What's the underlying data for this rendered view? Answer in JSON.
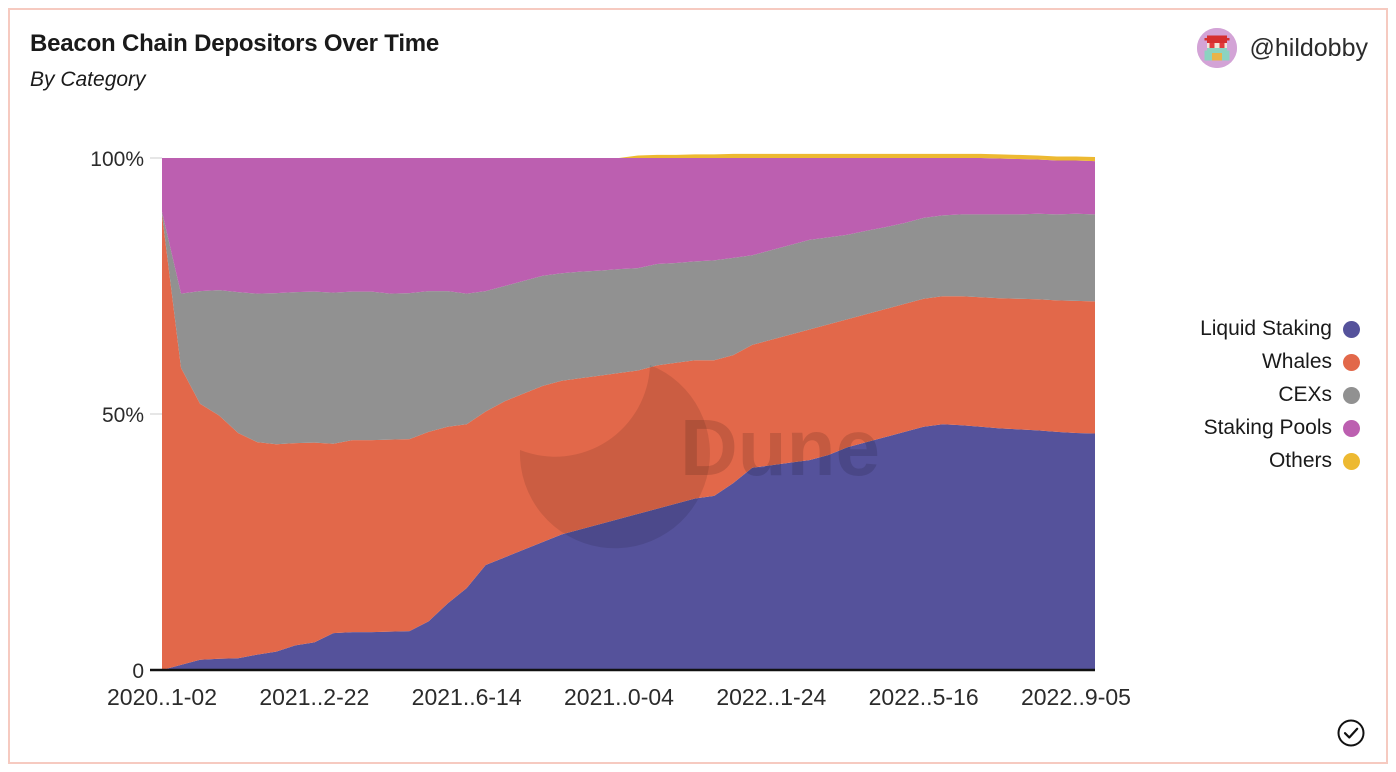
{
  "card": {
    "border_color": "#f6cac0",
    "background": "#ffffff"
  },
  "header": {
    "title": "Beacon Chain Depositors Over Time",
    "subtitle": "By Category",
    "author_handle": "@hildobby",
    "avatar_icon": "pixel-avatar-icon"
  },
  "watermark": {
    "text": "Dune",
    "logo_icon": "dune-crescent-icon"
  },
  "verified_badge": {
    "icon": "check-circle-icon"
  },
  "legend": {
    "position": "right",
    "items": [
      {
        "label": "Liquid Staking",
        "color": "#55529b"
      },
      {
        "label": "Whales",
        "color": "#e2684a"
      },
      {
        "label": "CEXs",
        "color": "#919191"
      },
      {
        "label": "Staking Pools",
        "color": "#bc5fb0"
      },
      {
        "label": "Others",
        "color": "#edb931"
      }
    ]
  },
  "chart_data": {
    "type": "area",
    "stacked": true,
    "normalized": true,
    "title": "Beacon Chain Depositors Over Time",
    "subtitle": "By Category",
    "xlabel": "",
    "ylabel": "",
    "grid": false,
    "ylim": [
      0,
      100
    ],
    "ytick_labels": [
      "0",
      "50%",
      "100%"
    ],
    "ytick_values": [
      0,
      50,
      100
    ],
    "xtick_labels": [
      "2020..1-02",
      "2021..2-22",
      "2021..6-14",
      "2021..0-04",
      "2022..1-24",
      "2022..5-16",
      "2022..9-05"
    ],
    "xtick_indices": [
      0,
      8,
      16,
      24,
      32,
      40,
      48
    ],
    "x": [
      0,
      1,
      2,
      3,
      4,
      5,
      6,
      7,
      8,
      9,
      10,
      11,
      12,
      13,
      14,
      15,
      16,
      17,
      18,
      19,
      20,
      21,
      22,
      23,
      24,
      25,
      26,
      27,
      28,
      29,
      30,
      31,
      32,
      33,
      34,
      35,
      36,
      37,
      38,
      39,
      40,
      41,
      42,
      43,
      44,
      45,
      46,
      47,
      48,
      49
    ],
    "series": [
      {
        "name": "Liquid Staking",
        "color": "#55529b",
        "values": [
          0,
          1.0,
          2.0,
          2.2,
          2.3,
          3.0,
          3.6,
          4.8,
          5.4,
          7.2,
          7.4,
          7.4,
          7.5,
          7.6,
          9.5,
          13.0,
          16.0,
          20.5,
          22.0,
          23.5,
          25.0,
          26.5,
          27.5,
          28.5,
          29.5,
          30.5,
          31.5,
          32.5,
          33.5,
          34.0,
          36.5,
          39.5,
          40.0,
          40.5,
          41.0,
          42.0,
          43.5,
          44.5,
          45.5,
          46.5,
          47.5,
          48.0,
          47.8,
          47.5,
          47.2,
          47.0,
          46.8,
          46.5,
          46.3,
          46.2
        ]
      },
      {
        "name": "Whales",
        "color": "#e2684a",
        "values": [
          89.0,
          58.0,
          50.0,
          47.5,
          44.0,
          41.5,
          40.5,
          39.5,
          39.0,
          37.0,
          37.5,
          37.5,
          37.5,
          37.5,
          37.0,
          34.5,
          32.0,
          30.0,
          30.5,
          30.5,
          30.5,
          30.0,
          29.5,
          29.0,
          28.5,
          28.0,
          28.0,
          27.5,
          27.0,
          26.5,
          25.0,
          24.0,
          24.5,
          25.0,
          25.5,
          25.5,
          25.0,
          25.0,
          25.0,
          25.0,
          25.0,
          25.0,
          25.2,
          25.3,
          25.4,
          25.5,
          25.6,
          25.7,
          25.8,
          25.8
        ]
      },
      {
        "name": "CEXs",
        "color": "#919191",
        "values": [
          0.5,
          14.5,
          22.0,
          24.5,
          27.5,
          29.0,
          29.5,
          29.5,
          29.5,
          29.5,
          29.0,
          29.0,
          28.5,
          28.5,
          27.5,
          26.5,
          25.5,
          23.5,
          22.5,
          22.0,
          21.5,
          21.0,
          20.8,
          20.5,
          20.3,
          20.0,
          19.8,
          19.5,
          19.3,
          19.5,
          19.0,
          17.5,
          17.5,
          17.5,
          17.5,
          17.0,
          16.5,
          16.3,
          16.0,
          15.8,
          15.8,
          15.8,
          16.0,
          16.2,
          16.4,
          16.5,
          16.7,
          16.8,
          17.0,
          17.0
        ]
      },
      {
        "name": "Staking Pools",
        "color": "#bc5fb0",
        "values": [
          10.5,
          26.5,
          26.0,
          25.8,
          26.2,
          26.5,
          26.4,
          26.2,
          26.1,
          26.3,
          26.1,
          26.1,
          26.5,
          26.4,
          26.0,
          26.0,
          26.5,
          26.0,
          25.0,
          24.0,
          23.0,
          22.5,
          22.2,
          22.0,
          21.7,
          21.5,
          20.7,
          20.5,
          20.2,
          20.0,
          19.5,
          19.0,
          18.0,
          17.0,
          16.0,
          15.5,
          15.0,
          14.2,
          13.5,
          12.7,
          11.7,
          11.2,
          11.0,
          11.0,
          10.9,
          10.8,
          10.6,
          10.5,
          10.4,
          10.4
        ]
      },
      {
        "name": "Others",
        "color": "#edb931",
        "values": [
          0,
          0,
          0,
          0,
          0,
          0,
          0,
          0,
          0,
          0,
          0,
          0,
          0,
          0,
          0,
          0,
          0,
          0,
          0,
          0,
          0,
          0,
          0,
          0,
          0,
          0.5,
          0.6,
          0.6,
          0.7,
          0.7,
          0.8,
          0.8,
          0.8,
          0.8,
          0.8,
          0.8,
          0.8,
          0.8,
          0.8,
          0.8,
          0.8,
          0.8,
          0.8,
          0.8,
          0.8,
          0.8,
          0.8,
          0.8,
          0.8,
          0.8
        ]
      }
    ]
  }
}
